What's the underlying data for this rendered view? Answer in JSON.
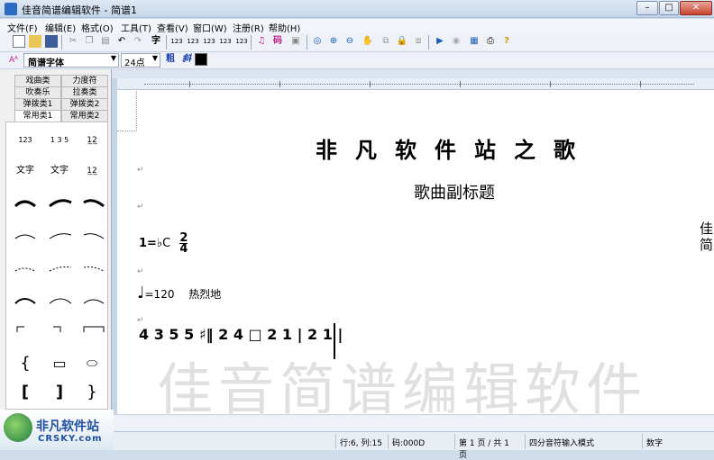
{
  "window": {
    "title": "佳音简谱编辑软件 - 简谱1",
    "min": "–",
    "max": "□",
    "close": "✕"
  },
  "menu": [
    "文件(F)",
    "编辑(E)",
    "格式(O)",
    "工具(T)",
    "查看(V)",
    "窗口(W)",
    "注册(R)",
    "帮助(H)"
  ],
  "toolbar": {
    "char_label": "字",
    "num1": "123",
    "num2": "123",
    "num3": "123",
    "num4": "123",
    "num5": "123",
    "code_label": "码"
  },
  "format_bar": {
    "font_icon": "Aᴬ",
    "font": "简谱字体",
    "size": "24点",
    "bold": "粗",
    "italic": "斜"
  },
  "palette_tabs": [
    "戏曲类",
    "力度符",
    "吹奏乐",
    "拉奏类",
    "弹拨类1",
    "弹拨类2",
    "常用类1",
    "常用类2"
  ],
  "palette": {
    "row1": [
      "1̇2̇3̇",
      "1 3 5",
      "1̲2̲"
    ],
    "row2": [
      "文字",
      "文字",
      "1̲2̲"
    ],
    "shapes": [
      "{",
      "▭",
      "⬭",
      "[",
      "]",
      "}"
    ]
  },
  "score": {
    "title": "非凡软件站之歌",
    "subtitle": "歌曲副标题",
    "key": "1=",
    "key_note": "♭C",
    "time_top": "2",
    "time_bottom": "4",
    "tempo_note": "♩",
    "tempo_value": "=120",
    "tempo_mark": "热烈地",
    "notes": "4 3 5 5 ♯‖ 2 4 □ 2 1 | 2 1 |",
    "watermark": "佳音简谱编辑软件",
    "right_glimpse": "佳\n简"
  },
  "statusbar": {
    "position": "行:6, 列:15",
    "code": "码:000D",
    "page": "第 1 页 / 共 1 页",
    "mode": "四分音符输入模式",
    "numlock": "数字"
  },
  "logo": {
    "cn": "非凡软件站",
    "en": "CRSKY.com"
  }
}
